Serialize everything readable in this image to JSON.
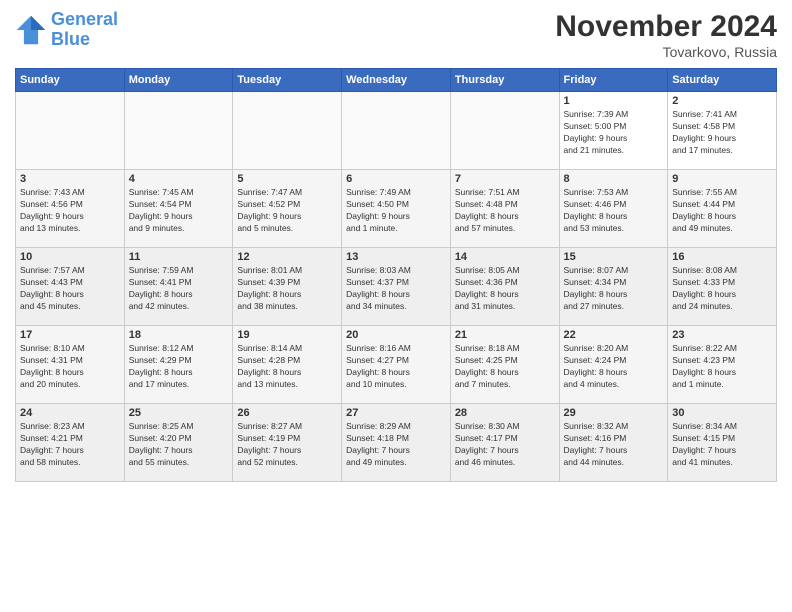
{
  "logo": {
    "line1": "General",
    "line2": "Blue"
  },
  "title": "November 2024",
  "location": "Tovarkovo, Russia",
  "days_of_week": [
    "Sunday",
    "Monday",
    "Tuesday",
    "Wednesday",
    "Thursday",
    "Friday",
    "Saturday"
  ],
  "weeks": [
    [
      {
        "day": "",
        "info": ""
      },
      {
        "day": "",
        "info": ""
      },
      {
        "day": "",
        "info": ""
      },
      {
        "day": "",
        "info": ""
      },
      {
        "day": "",
        "info": ""
      },
      {
        "day": "1",
        "info": "Sunrise: 7:39 AM\nSunset: 5:00 PM\nDaylight: 9 hours\nand 21 minutes."
      },
      {
        "day": "2",
        "info": "Sunrise: 7:41 AM\nSunset: 4:58 PM\nDaylight: 9 hours\nand 17 minutes."
      }
    ],
    [
      {
        "day": "3",
        "info": "Sunrise: 7:43 AM\nSunset: 4:56 PM\nDaylight: 9 hours\nand 13 minutes."
      },
      {
        "day": "4",
        "info": "Sunrise: 7:45 AM\nSunset: 4:54 PM\nDaylight: 9 hours\nand 9 minutes."
      },
      {
        "day": "5",
        "info": "Sunrise: 7:47 AM\nSunset: 4:52 PM\nDaylight: 9 hours\nand 5 minutes."
      },
      {
        "day": "6",
        "info": "Sunrise: 7:49 AM\nSunset: 4:50 PM\nDaylight: 9 hours\nand 1 minute."
      },
      {
        "day": "7",
        "info": "Sunrise: 7:51 AM\nSunset: 4:48 PM\nDaylight: 8 hours\nand 57 minutes."
      },
      {
        "day": "8",
        "info": "Sunrise: 7:53 AM\nSunset: 4:46 PM\nDaylight: 8 hours\nand 53 minutes."
      },
      {
        "day": "9",
        "info": "Sunrise: 7:55 AM\nSunset: 4:44 PM\nDaylight: 8 hours\nand 49 minutes."
      }
    ],
    [
      {
        "day": "10",
        "info": "Sunrise: 7:57 AM\nSunset: 4:43 PM\nDaylight: 8 hours\nand 45 minutes."
      },
      {
        "day": "11",
        "info": "Sunrise: 7:59 AM\nSunset: 4:41 PM\nDaylight: 8 hours\nand 42 minutes."
      },
      {
        "day": "12",
        "info": "Sunrise: 8:01 AM\nSunset: 4:39 PM\nDaylight: 8 hours\nand 38 minutes."
      },
      {
        "day": "13",
        "info": "Sunrise: 8:03 AM\nSunset: 4:37 PM\nDaylight: 8 hours\nand 34 minutes."
      },
      {
        "day": "14",
        "info": "Sunrise: 8:05 AM\nSunset: 4:36 PM\nDaylight: 8 hours\nand 31 minutes."
      },
      {
        "day": "15",
        "info": "Sunrise: 8:07 AM\nSunset: 4:34 PM\nDaylight: 8 hours\nand 27 minutes."
      },
      {
        "day": "16",
        "info": "Sunrise: 8:08 AM\nSunset: 4:33 PM\nDaylight: 8 hours\nand 24 minutes."
      }
    ],
    [
      {
        "day": "17",
        "info": "Sunrise: 8:10 AM\nSunset: 4:31 PM\nDaylight: 8 hours\nand 20 minutes."
      },
      {
        "day": "18",
        "info": "Sunrise: 8:12 AM\nSunset: 4:29 PM\nDaylight: 8 hours\nand 17 minutes."
      },
      {
        "day": "19",
        "info": "Sunrise: 8:14 AM\nSunset: 4:28 PM\nDaylight: 8 hours\nand 13 minutes."
      },
      {
        "day": "20",
        "info": "Sunrise: 8:16 AM\nSunset: 4:27 PM\nDaylight: 8 hours\nand 10 minutes."
      },
      {
        "day": "21",
        "info": "Sunrise: 8:18 AM\nSunset: 4:25 PM\nDaylight: 8 hours\nand 7 minutes."
      },
      {
        "day": "22",
        "info": "Sunrise: 8:20 AM\nSunset: 4:24 PM\nDaylight: 8 hours\nand 4 minutes."
      },
      {
        "day": "23",
        "info": "Sunrise: 8:22 AM\nSunset: 4:23 PM\nDaylight: 8 hours\nand 1 minute."
      }
    ],
    [
      {
        "day": "24",
        "info": "Sunrise: 8:23 AM\nSunset: 4:21 PM\nDaylight: 7 hours\nand 58 minutes."
      },
      {
        "day": "25",
        "info": "Sunrise: 8:25 AM\nSunset: 4:20 PM\nDaylight: 7 hours\nand 55 minutes."
      },
      {
        "day": "26",
        "info": "Sunrise: 8:27 AM\nSunset: 4:19 PM\nDaylight: 7 hours\nand 52 minutes."
      },
      {
        "day": "27",
        "info": "Sunrise: 8:29 AM\nSunset: 4:18 PM\nDaylight: 7 hours\nand 49 minutes."
      },
      {
        "day": "28",
        "info": "Sunrise: 8:30 AM\nSunset: 4:17 PM\nDaylight: 7 hours\nand 46 minutes."
      },
      {
        "day": "29",
        "info": "Sunrise: 8:32 AM\nSunset: 4:16 PM\nDaylight: 7 hours\nand 44 minutes."
      },
      {
        "day": "30",
        "info": "Sunrise: 8:34 AM\nSunset: 4:15 PM\nDaylight: 7 hours\nand 41 minutes."
      }
    ]
  ]
}
